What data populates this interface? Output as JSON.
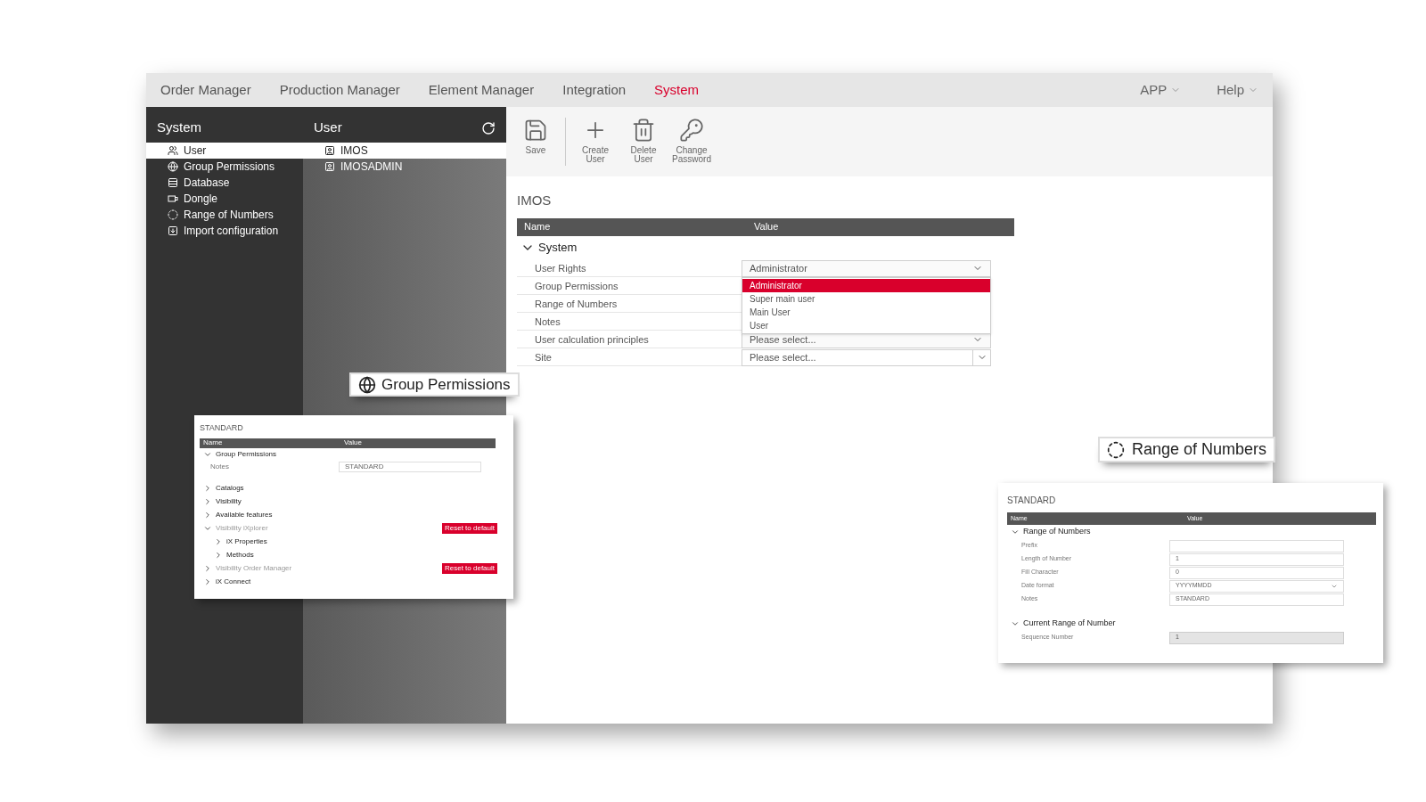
{
  "nav": {
    "items": [
      {
        "label": "Order Manager",
        "selected": false
      },
      {
        "label": "Production Manager",
        "selected": false
      },
      {
        "label": "Element Manager",
        "selected": false
      },
      {
        "label": "Integration",
        "selected": false
      },
      {
        "label": "System",
        "selected": true
      }
    ],
    "menus": [
      {
        "label": "APP"
      },
      {
        "label": "Help"
      }
    ]
  },
  "sidebar": {
    "title": "System",
    "items": [
      {
        "label": "User",
        "selected": true
      },
      {
        "label": "Group Permissions",
        "selected": false
      },
      {
        "label": "Database",
        "selected": false
      },
      {
        "label": "Dongle",
        "selected": false
      },
      {
        "label": "Range of Numbers",
        "selected": false
      },
      {
        "label": "Import configuration",
        "selected": false
      }
    ]
  },
  "user_list": {
    "title": "User",
    "items": [
      {
        "label": "IMOS",
        "selected": true
      },
      {
        "label": "IMOSADMIN",
        "selected": false
      }
    ]
  },
  "toolbar": [
    {
      "label": "Save"
    },
    {
      "label": "Create User"
    },
    {
      "label": "Delete User"
    },
    {
      "label": "Change Password"
    }
  ],
  "record": {
    "title": "IMOS",
    "columns": [
      "Name",
      "Value"
    ],
    "group": {
      "label": "System",
      "expanded": true
    },
    "rows": [
      {
        "label": "User Rights",
        "kind": "select",
        "value": "Administrator"
      },
      {
        "label": "Group Permissions",
        "kind": "hidden"
      },
      {
        "label": "Range of Numbers",
        "kind": "hidden"
      },
      {
        "label": "Notes",
        "kind": "hidden"
      },
      {
        "label": "User calculation principles",
        "kind": "select",
        "value": "Please select..."
      },
      {
        "label": "Site",
        "kind": "combo",
        "value": "Please select..."
      }
    ],
    "dropdown": [
      {
        "label": "Administrator",
        "selected": true
      },
      {
        "label": "Super main user",
        "selected": false
      },
      {
        "label": "Main User",
        "selected": false
      },
      {
        "label": "User",
        "selected": false
      }
    ]
  },
  "group_permissions_panel": {
    "callout": "Group Permissions",
    "title": "STANDARD",
    "columns": [
      "Name",
      "Value"
    ],
    "group": {
      "label": "Group Permissions",
      "expanded": true
    },
    "rows": [
      {
        "label": "Notes",
        "value": "STANDARD"
      }
    ],
    "tree": [
      {
        "label": "Catalogs",
        "expanded": false,
        "disabled": false
      },
      {
        "label": "Visibility",
        "expanded": false,
        "disabled": false
      },
      {
        "label": "Available features",
        "expanded": false,
        "disabled": false
      },
      {
        "label": "Visibility iXplorer",
        "expanded": true,
        "disabled": true,
        "action": "Reset to default",
        "children": [
          {
            "label": "iX Properties",
            "expanded": false,
            "disabled": false
          },
          {
            "label": "Methods",
            "expanded": false,
            "disabled": false
          }
        ]
      },
      {
        "label": "Visibility Order Manager",
        "expanded": false,
        "disabled": true,
        "action": "Reset to default"
      },
      {
        "label": "iX Connect",
        "expanded": false,
        "disabled": false
      }
    ]
  },
  "range_panel": {
    "callout": "Range of Numbers",
    "title": "STANDARD",
    "columns": [
      "Name",
      "Value"
    ],
    "groups": [
      {
        "label": "Range of Numbers",
        "expanded": true,
        "rows": [
          {
            "label": "Prefix",
            "kind": "text"
          },
          {
            "label": "Length of Number",
            "kind": "text",
            "value": "1"
          },
          {
            "label": "Fill Character",
            "kind": "text",
            "value": "0"
          },
          {
            "label": "Date format",
            "kind": "select",
            "value": "YYYYMMDD"
          },
          {
            "label": "Notes",
            "kind": "text",
            "value": "STANDARD"
          }
        ]
      },
      {
        "label": "Current Range of Number",
        "expanded": true,
        "rows": [
          {
            "label": "Sequence Number",
            "kind": "readonly",
            "value": "1"
          }
        ]
      }
    ]
  }
}
